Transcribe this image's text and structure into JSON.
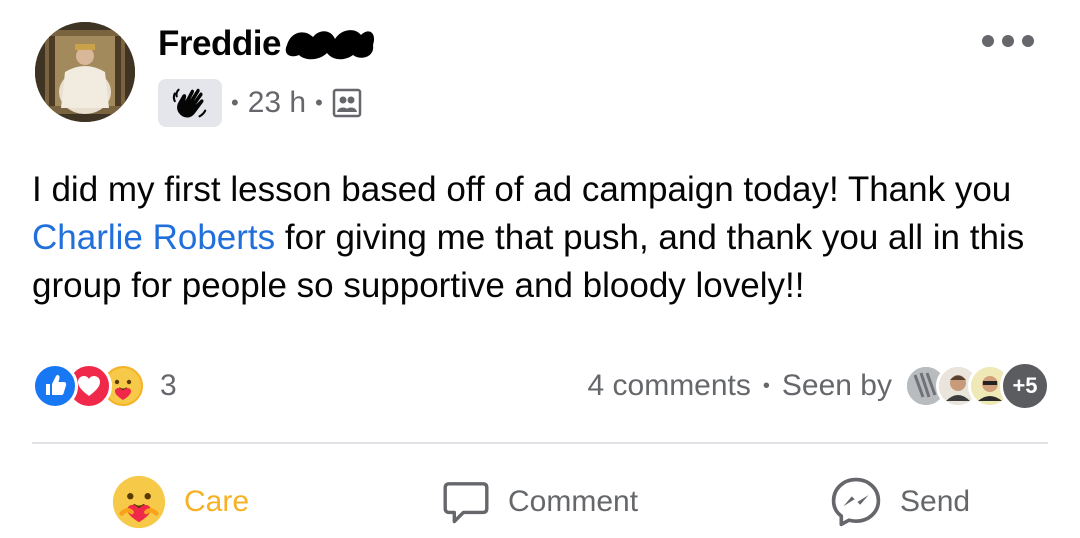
{
  "post": {
    "author": {
      "name": "Freddie"
    },
    "meta": {
      "time": "23 h",
      "privacy_icon": "group-members-icon",
      "badge_icon": "waving-hand-icon"
    },
    "text": {
      "part1": "I did my first lesson based off of ad campaign today! Thank you ",
      "mention": "Charlie Roberts",
      "part2": " for giving me that push, and thank you all in this group for people so supportive and bloody lovely!!"
    },
    "reactions": {
      "icons": [
        "like-reaction-icon",
        "love-reaction-icon",
        "care-reaction-icon"
      ],
      "count": "3"
    },
    "stats": {
      "comments": "4 comments",
      "seen_by": "Seen by",
      "seen_more": "+5"
    },
    "actions": {
      "care": "Care",
      "comment": "Comment",
      "send": "Send"
    },
    "colors": {
      "mention": "#216fdb",
      "care_label": "#f7b125",
      "like_blue": "#1877f2",
      "love_red": "#f0284a",
      "muted_text": "#65676b"
    }
  }
}
